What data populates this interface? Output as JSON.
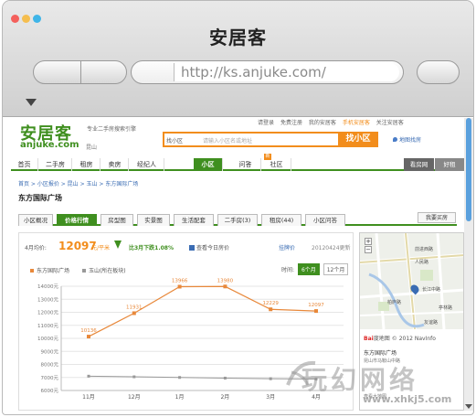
{
  "window": {
    "title": "安居客",
    "url": "http://ks.anjuke.com/"
  },
  "header": {
    "top_links": [
      "请登录",
      "免费注册",
      "我的安居客",
      "手机安居客",
      "关注安居客"
    ],
    "logo_cn": "安居客",
    "logo_en": "anjuke.com",
    "city": "昆山",
    "slogan": "专业二手房搜索引擎",
    "search_select": "找小区",
    "search_placeholder": "请输入小区名或地址",
    "search_button": "找小区",
    "map_link": "地图找房"
  },
  "nav": {
    "items": [
      "首页",
      "二手房",
      "租房",
      "卖房",
      "经纪人",
      "小区",
      "问答",
      "社区"
    ],
    "active": "小区",
    "badge": "新",
    "right_items": [
      "看房网",
      "好租"
    ]
  },
  "breadcrumb": "首页 > 小区报价 > 昆山 > 玉山 > 东方国际广场",
  "estate_title": "东方国际广场",
  "tabs": {
    "items": [
      "小区概况",
      "价格行情",
      "房型图",
      "实景图",
      "生活配套",
      "二手房(3)",
      "租房(44)",
      "小区问答"
    ],
    "active": "价格行情",
    "side": "我要买房"
  },
  "price": {
    "label": "4月均价:",
    "value": "12097",
    "unit": "元/平米",
    "change": "比3月下跌1.08%",
    "subscribe": "查看今日房价",
    "announce": "挂牌价",
    "date": "20120424更新"
  },
  "time_selector": {
    "label": "时间:",
    "options": [
      "6个月",
      "12个月"
    ],
    "active": "6个月"
  },
  "chart_data": {
    "type": "line",
    "categories": [
      "11月",
      "12月",
      "1月",
      "2月",
      "3月",
      "4月"
    ],
    "series": [
      {
        "name": "东方国际广场",
        "values": [
          10136,
          11931,
          13966,
          13980,
          12229,
          12097
        ],
        "labels": [
          "10136",
          "11931",
          "13966",
          "13980",
          "12229",
          "12097"
        ],
        "color": "#e8883a"
      },
      {
        "name": "玉山(所在板块)",
        "values": [
          7100,
          7050,
          7000,
          6950,
          6900,
          6880
        ],
        "color": "#999999"
      }
    ],
    "yticks": [
      "14000元",
      "13000元",
      "12000元",
      "11000元",
      "10000元",
      "9000元",
      "8000元",
      "7000元",
      "6000元"
    ],
    "ylim": [
      6000,
      14000
    ]
  },
  "map": {
    "labels": [
      "前进西路",
      "人民路",
      "长江中路",
      "柏庐路",
      "亭林路",
      "友谊路"
    ],
    "brand": "Bai",
    "brand_suffix": "度地图",
    "copyright": "© 2012 NavInfo",
    "estate": "东方国际广场",
    "address": "昆山市马鞍山中路",
    "more": "查看大地图"
  },
  "watermark": {
    "text": "玩幻网络",
    "url": "www.xhkj5.com"
  }
}
